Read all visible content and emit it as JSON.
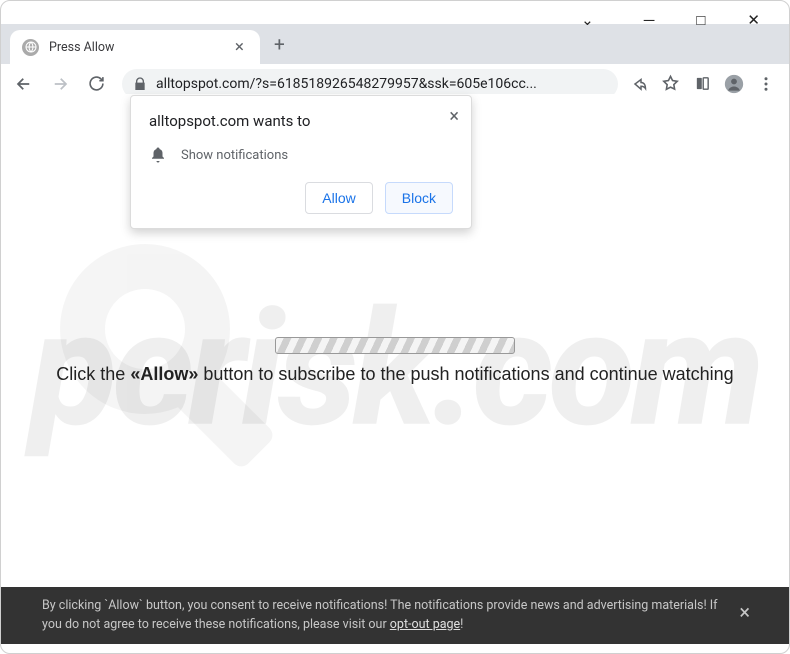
{
  "window": {
    "tab_title": "Press Allow",
    "url": "alltopspot.com/?s=618518926548279957&ssk=605e106cc..."
  },
  "notification": {
    "title": "alltopspot.com wants to",
    "body": "Show notifications",
    "allow": "Allow",
    "block": "Block"
  },
  "page": {
    "instruction_pre": "Click the ",
    "instruction_bold": "«Allow»",
    "instruction_post": " button to subscribe to the push notifications and continue watching"
  },
  "banner": {
    "text_pre": "By clicking `Allow` button, you consent to receive notifications! The notifications provide news and advertising materials! If you do not agree to receive these notifications, please visit our ",
    "link": "opt-out page",
    "text_post": "!"
  },
  "watermark": "pcrisk.com"
}
